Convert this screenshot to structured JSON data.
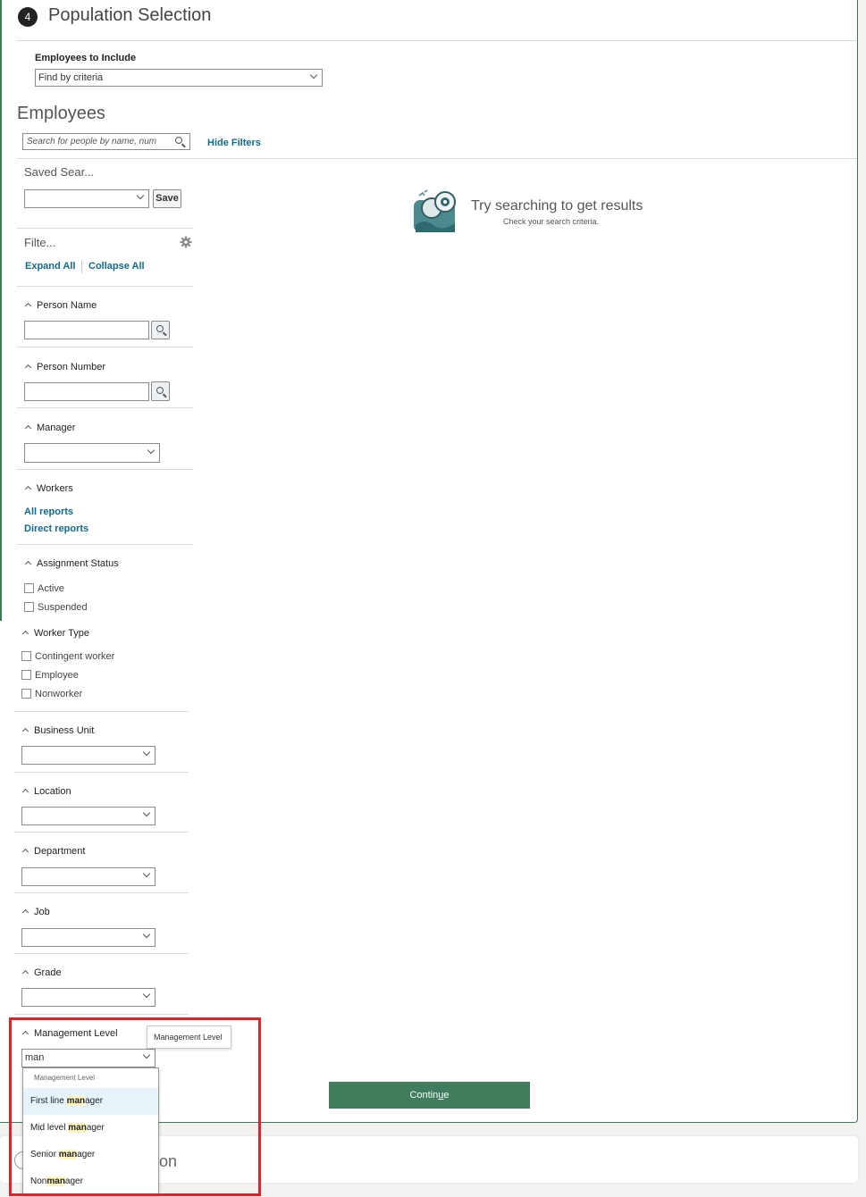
{
  "step": {
    "number": "4",
    "title": "Population Selection"
  },
  "include": {
    "label": "Employees to Include",
    "value": "Find by criteria"
  },
  "employees": {
    "heading": "Employees",
    "search_placeholder": "Search for people by name, num",
    "hide_filters": "Hide Filters"
  },
  "saved_search": {
    "label": "Saved Sear...",
    "value": "",
    "save_label": "Save"
  },
  "filters": {
    "label": "Filte...",
    "expand_all": "Expand All",
    "collapse_all": "Collapse All"
  },
  "sections": {
    "person_name": "Person Name",
    "person_number": "Person Number",
    "manager": "Manager",
    "workers": {
      "title": "Workers",
      "all_reports": "All reports",
      "direct_reports": "Direct reports"
    },
    "assignment_status": {
      "title": "Assignment Status",
      "options": [
        "Active",
        "Suspended"
      ]
    },
    "worker_type": {
      "title": "Worker Type",
      "options": [
        "Contingent worker",
        "Employee",
        "Nonworker"
      ]
    },
    "business_unit": "Business Unit",
    "location": "Location",
    "department": "Department",
    "job": "Job",
    "grade": "Grade",
    "management_level": {
      "title": "Management Level",
      "value": "man"
    }
  },
  "tooltip": "Management Level",
  "dropdown": {
    "header": "Management Level",
    "items": [
      {
        "pre": "First line ",
        "match": "man",
        "post": "ager"
      },
      {
        "pre": "Mid level ",
        "match": "man",
        "post": "ager"
      },
      {
        "pre": "Senior ",
        "match": "man",
        "post": "ager"
      },
      {
        "pre": "Non",
        "match": "man",
        "post": "ager"
      }
    ]
  },
  "empty_state": {
    "title": "Try searching to get results",
    "subtitle": "Check your search criteria."
  },
  "continue": {
    "pre": "Contin",
    "underline": "u",
    "post": "e"
  },
  "next_step": {
    "title_fragment": "on"
  },
  "colors": {
    "accent_green": "#3f7d5c",
    "link_blue": "#0f6b8f",
    "highlight_red": "#e1212b",
    "match_yellow": "#fdf6c1"
  }
}
